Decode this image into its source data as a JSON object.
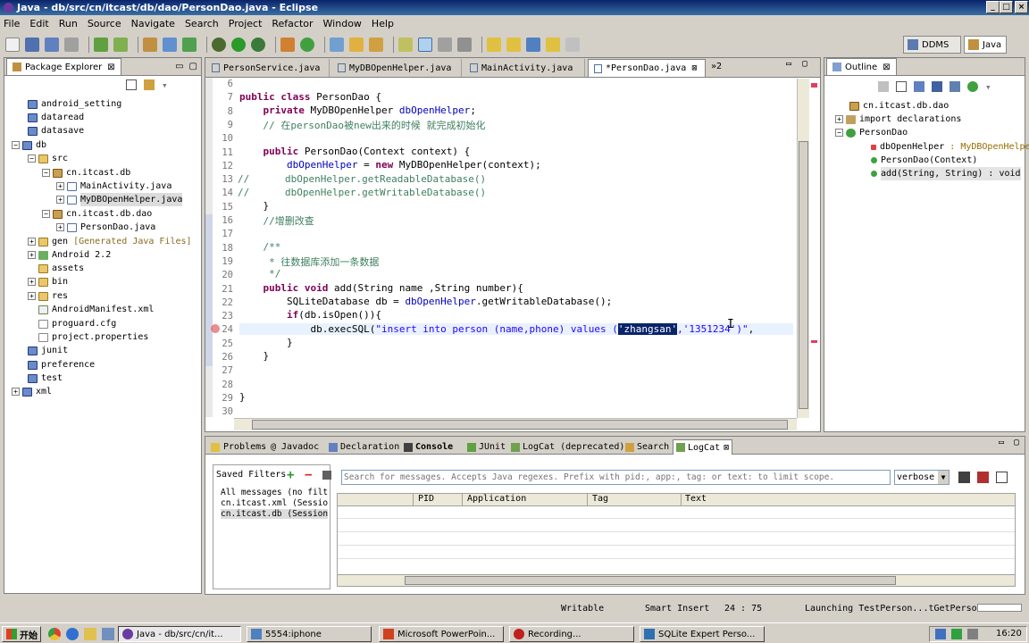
{
  "window": {
    "title": "Java - db/src/cn/itcast/db/dao/PersonDao.java - Eclipse"
  },
  "menu": [
    "File",
    "Edit",
    "Run",
    "Source",
    "Navigate",
    "Search",
    "Project",
    "Refactor",
    "Window",
    "Help"
  ],
  "perspectives": {
    "ddms": "DDMS",
    "java": "Java"
  },
  "package_explorer": {
    "title": "Package Explorer",
    "items": [
      {
        "label": "android_setting",
        "kind": "project",
        "level": 1
      },
      {
        "label": "dataread",
        "kind": "project",
        "level": 1
      },
      {
        "label": "datasave",
        "kind": "project",
        "level": 1
      },
      {
        "label": "db",
        "kind": "project",
        "level": 0,
        "expanded": true
      },
      {
        "label": "src",
        "kind": "folder",
        "level": 2
      },
      {
        "label": "cn.itcast.db",
        "kind": "package",
        "level": 3
      },
      {
        "label": "MainActivity.java",
        "kind": "java",
        "level": 4
      },
      {
        "label": "MyDBOpenHelper.java",
        "kind": "java",
        "level": 4,
        "selected": true
      },
      {
        "label": "cn.itcast.db.dao",
        "kind": "package",
        "level": 3
      },
      {
        "label": "PersonDao.java",
        "kind": "java",
        "level": 4
      },
      {
        "label": "gen",
        "extra": "[Generated Java Files]",
        "kind": "folder",
        "level": 2
      },
      {
        "label": "Android 2.2",
        "kind": "lib",
        "level": 2
      },
      {
        "label": "assets",
        "kind": "folder",
        "level": 2
      },
      {
        "label": "bin",
        "kind": "folder",
        "level": 2
      },
      {
        "label": "res",
        "kind": "folder",
        "level": 2
      },
      {
        "label": "AndroidManifest.xml",
        "kind": "file",
        "level": 2
      },
      {
        "label": "proguard.cfg",
        "kind": "file",
        "level": 2
      },
      {
        "label": "project.properties",
        "kind": "file",
        "level": 2
      },
      {
        "label": "junit",
        "kind": "project",
        "level": 1
      },
      {
        "label": "preference",
        "kind": "project",
        "level": 1
      },
      {
        "label": "test",
        "kind": "project",
        "level": 1
      },
      {
        "label": "xml",
        "kind": "project",
        "level": 0
      }
    ]
  },
  "editor": {
    "tabs": [
      "PersonService.java",
      "MyDBOpenHelper.java",
      "MainActivity.java",
      "*PersonDao.java"
    ],
    "overflow": "»2",
    "line_numbers": [
      "6",
      "7",
      "8",
      "9",
      "10",
      "11",
      "12",
      "13",
      "14",
      "15",
      "16",
      "17",
      "18",
      "19",
      "20",
      "21",
      "22",
      "23",
      "24",
      "25",
      "26",
      "27",
      "28",
      "29",
      "30"
    ]
  },
  "outline": {
    "title": "Outline",
    "items": [
      {
        "label": "cn.itcast.db.dao"
      },
      {
        "label": "import declarations"
      },
      {
        "label": "PersonDao"
      },
      {
        "label": "dbOpenHelper",
        "type": ": MyDBOpenHelper"
      },
      {
        "label": "PersonDao(Context)"
      },
      {
        "label": "add(String, String) : void"
      }
    ]
  },
  "bottom_tabs": [
    "Problems",
    "@ Javadoc",
    "Declaration",
    "Console",
    "JUnit",
    "LogCat (deprecated)",
    "Search",
    "LogCat"
  ],
  "logcat": {
    "saved_filters_title": "Saved Filters",
    "filters": [
      "All messages (no filters)",
      "cn.itcast.xml (Session Filter)",
      "cn.itcast.db (Session Filter)"
    ],
    "search_placeholder": "Search for messages. Accepts Java regexes. Prefix with pid:, app:, tag: or text: to limit scope.",
    "level": "verbose",
    "columns": [
      "",
      "PID",
      "Application",
      "Tag",
      "Text"
    ]
  },
  "status": {
    "writable": "Writable",
    "insert": "Smart Insert",
    "position": "24 : 75",
    "task": "Launching TestPerson...tGetPersons"
  },
  "taskbar": {
    "start": "开始",
    "tasks": [
      "Java - db/src/cn/it...",
      "5554:iphone",
      "Microsoft PowerPoin...",
      "Recording...",
      "SQLite Expert Perso..."
    ],
    "clock": "16:20"
  }
}
